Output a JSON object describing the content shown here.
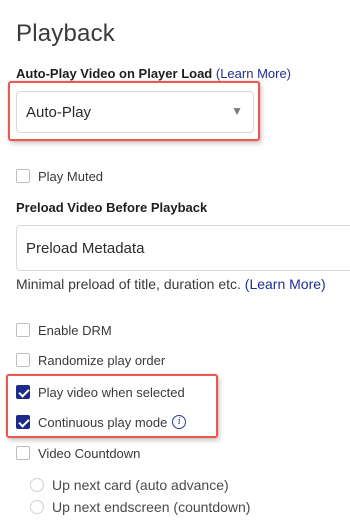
{
  "playback": {
    "title": "Playback",
    "autoplay": {
      "label": "Auto-Play Video on Player Load",
      "learn_more": "(Learn More)",
      "selected": "Auto-Play"
    },
    "play_muted": {
      "label": "Play Muted",
      "checked": false
    },
    "preload": {
      "label": "Preload Video Before Playback",
      "selected": "Preload Metadata",
      "help": "Minimal preload of title, duration etc.",
      "learn_more": "(Learn More)"
    },
    "enable_drm": {
      "label": "Enable DRM",
      "checked": false
    },
    "randomize": {
      "label": "Randomize play order",
      "checked": false
    },
    "play_when_selected": {
      "label": "Play video when selected",
      "checked": true
    },
    "continuous_play": {
      "label": "Continuous play mode",
      "checked": true
    },
    "video_countdown": {
      "label": "Video Countdown",
      "checked": false,
      "options": [
        "Up next card (auto advance)",
        "Up next endscreen (countdown)"
      ]
    }
  },
  "colors": {
    "accent": "#1d2a8a",
    "link": "#1f2f8f",
    "highlight": "#e85a50"
  }
}
